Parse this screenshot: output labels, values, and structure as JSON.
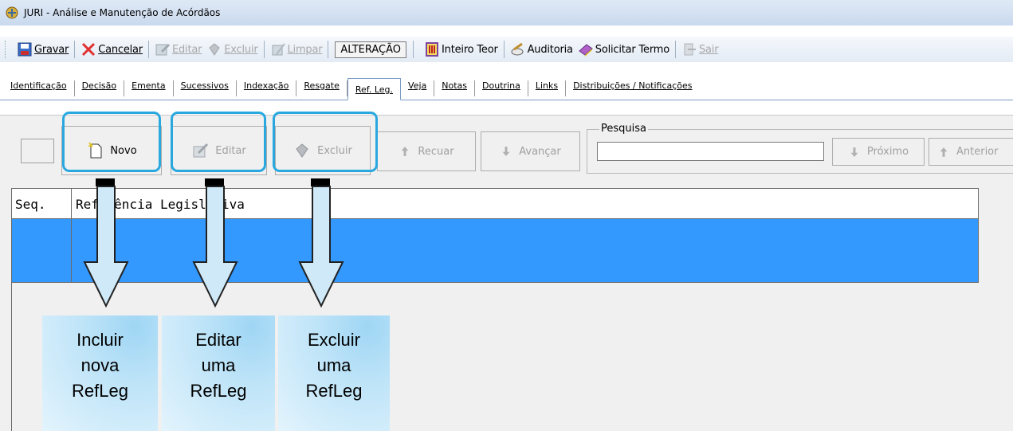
{
  "window": {
    "title": "JURI - Análise e Manutenção de Acórdãos"
  },
  "toolbar": {
    "gravar": "Gravar",
    "cancelar": "Cancelar",
    "editar": "Editar",
    "excluir": "Excluir",
    "limpar": "Limpar",
    "mode": "ALTERAÇÃO",
    "inteiro_teor": "Inteiro Teor",
    "auditoria": "Auditoria",
    "solicitar_termo": "Solicitar Termo",
    "sair": "Sair"
  },
  "tabs": [
    {
      "label": "Identificação"
    },
    {
      "label": "Decisão"
    },
    {
      "label": "Ementa"
    },
    {
      "label": "Sucessivos"
    },
    {
      "label": "Indexação"
    },
    {
      "label": "Resgate"
    },
    {
      "label": "Ref. Leg."
    },
    {
      "label": "Veja"
    },
    {
      "label": "Notas"
    },
    {
      "label": "Doutrina"
    },
    {
      "label": "Links"
    },
    {
      "label": "Distribuições / Notificações"
    }
  ],
  "actions": {
    "novo": "Novo",
    "editar": "Editar",
    "excluir": "Excluir",
    "recuar": "Recuar",
    "avancar": "Avançar",
    "proximo": "Próximo",
    "anterior": "Anterior"
  },
  "search": {
    "label": "Pesquisa",
    "value": ""
  },
  "grid": {
    "columns": [
      "Seq.",
      "Referência Legislativa"
    ]
  },
  "callouts": {
    "incluir": [
      "Incluir",
      "nova",
      "RefLeg"
    ],
    "editar": [
      "Editar",
      "uma",
      "RefLeg"
    ],
    "excluir": [
      "Excluir",
      "uma",
      "RefLeg"
    ]
  },
  "colors": {
    "highlight": "#29a8e0",
    "selection": "#3399ff"
  }
}
